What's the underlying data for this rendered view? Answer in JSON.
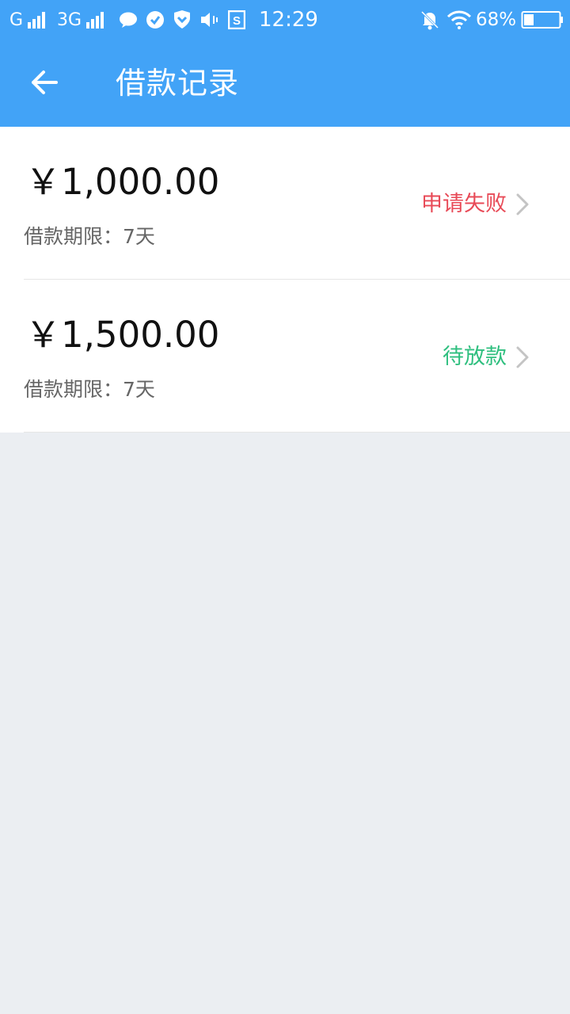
{
  "statusbar": {
    "carrier1": "G",
    "carrier2": "3G",
    "time": "12:29",
    "battery": "68%"
  },
  "nav": {
    "title": "借款记录"
  },
  "records": [
    {
      "amount": "￥1,000.00",
      "term": "借款期限：7天",
      "status": "申请失败",
      "status_color": "#e84a57"
    },
    {
      "amount": "￥1,500.00",
      "term": "借款期限：7天",
      "status": "待放款",
      "status_color": "#2fbf7f"
    }
  ],
  "colors": {
    "header": "#42a3f7",
    "page_bg": "#ebeef2"
  }
}
